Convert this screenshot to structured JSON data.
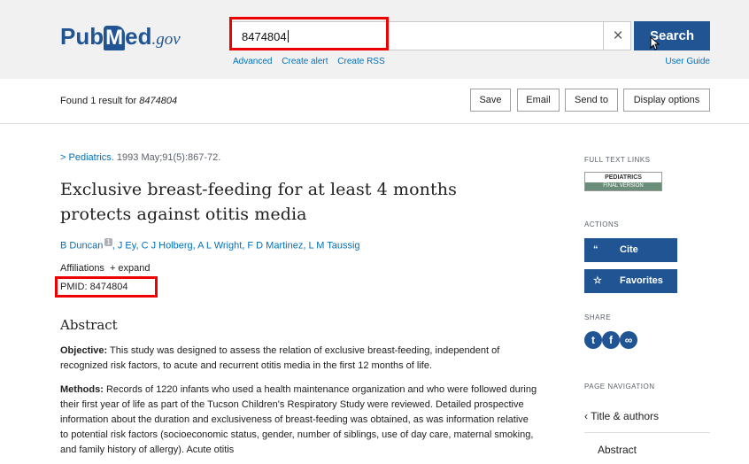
{
  "header": {
    "logo": {
      "pub": "Pub",
      "m": "M",
      "ed": "ed",
      "gov": ".gov"
    },
    "search": {
      "value": "8474804",
      "clear": "×",
      "button": "Search"
    },
    "links": [
      "Advanced",
      "Create alert",
      "Create RSS"
    ],
    "user_guide": "User Guide"
  },
  "results": {
    "found_prefix": "Found 1 result for ",
    "found_term": "8474804",
    "buttons": [
      "Save",
      "Email",
      "Send to",
      "Display options"
    ]
  },
  "article": {
    "journal_arrow": ">",
    "journal": "Pediatrics.",
    "citation": " 1993 May;91(5):867-72.",
    "title": "Exclusive breast-feeding for at least 4 months protects against otitis media",
    "authors_first": "B Duncan",
    "authors_sup": "1",
    "authors_rest": ", J Ey, C J Holberg, A L Wright, F D Martinez, L M Taussig",
    "affiliations": "Affiliations",
    "expand": "+ expand",
    "pmid": "PMID: 8474804",
    "abstract_heading": "Abstract",
    "objective_label": "Objective:",
    "objective_text": " This study was designed to assess the relation of exclusive breast-feeding, independent of recognized risk factors, to acute and recurrent otitis media in the first 12 months of life.",
    "methods_label": "Methods:",
    "methods_text": " Records of 1220 infants who used a health maintenance organization and who were followed during their first year of life as part of the Tucson Children's Respiratory Study were reviewed. Detailed prospective information about the duration and exclusiveness of breast-feeding was obtained, as was information relative to potential risk factors (socioeconomic status, gender, number of siblings, use of day care, maternal smoking, and family history of allergy). Acute otitis"
  },
  "sidebar": {
    "full_text_label": "FULL TEXT LINKS",
    "badge_top": "PEDIATRICS",
    "badge_bottom": "FINAL VERSION",
    "actions_label": "ACTIONS",
    "cite": "Cite",
    "cite_icon": "“",
    "favorites": "Favorites",
    "favorites_icon": "☆",
    "share_label": "SHARE",
    "share_icons": [
      "twitter-icon",
      "facebook-icon",
      "link-icon"
    ],
    "page_nav_label": "PAGE NAVIGATION",
    "nav_title": "Title & authors",
    "nav_arrow": "‹",
    "nav_abstract": "Abstract"
  },
  "colors": {
    "brand": "#205493",
    "link": "#0071bc",
    "highlight": "#e00000"
  }
}
